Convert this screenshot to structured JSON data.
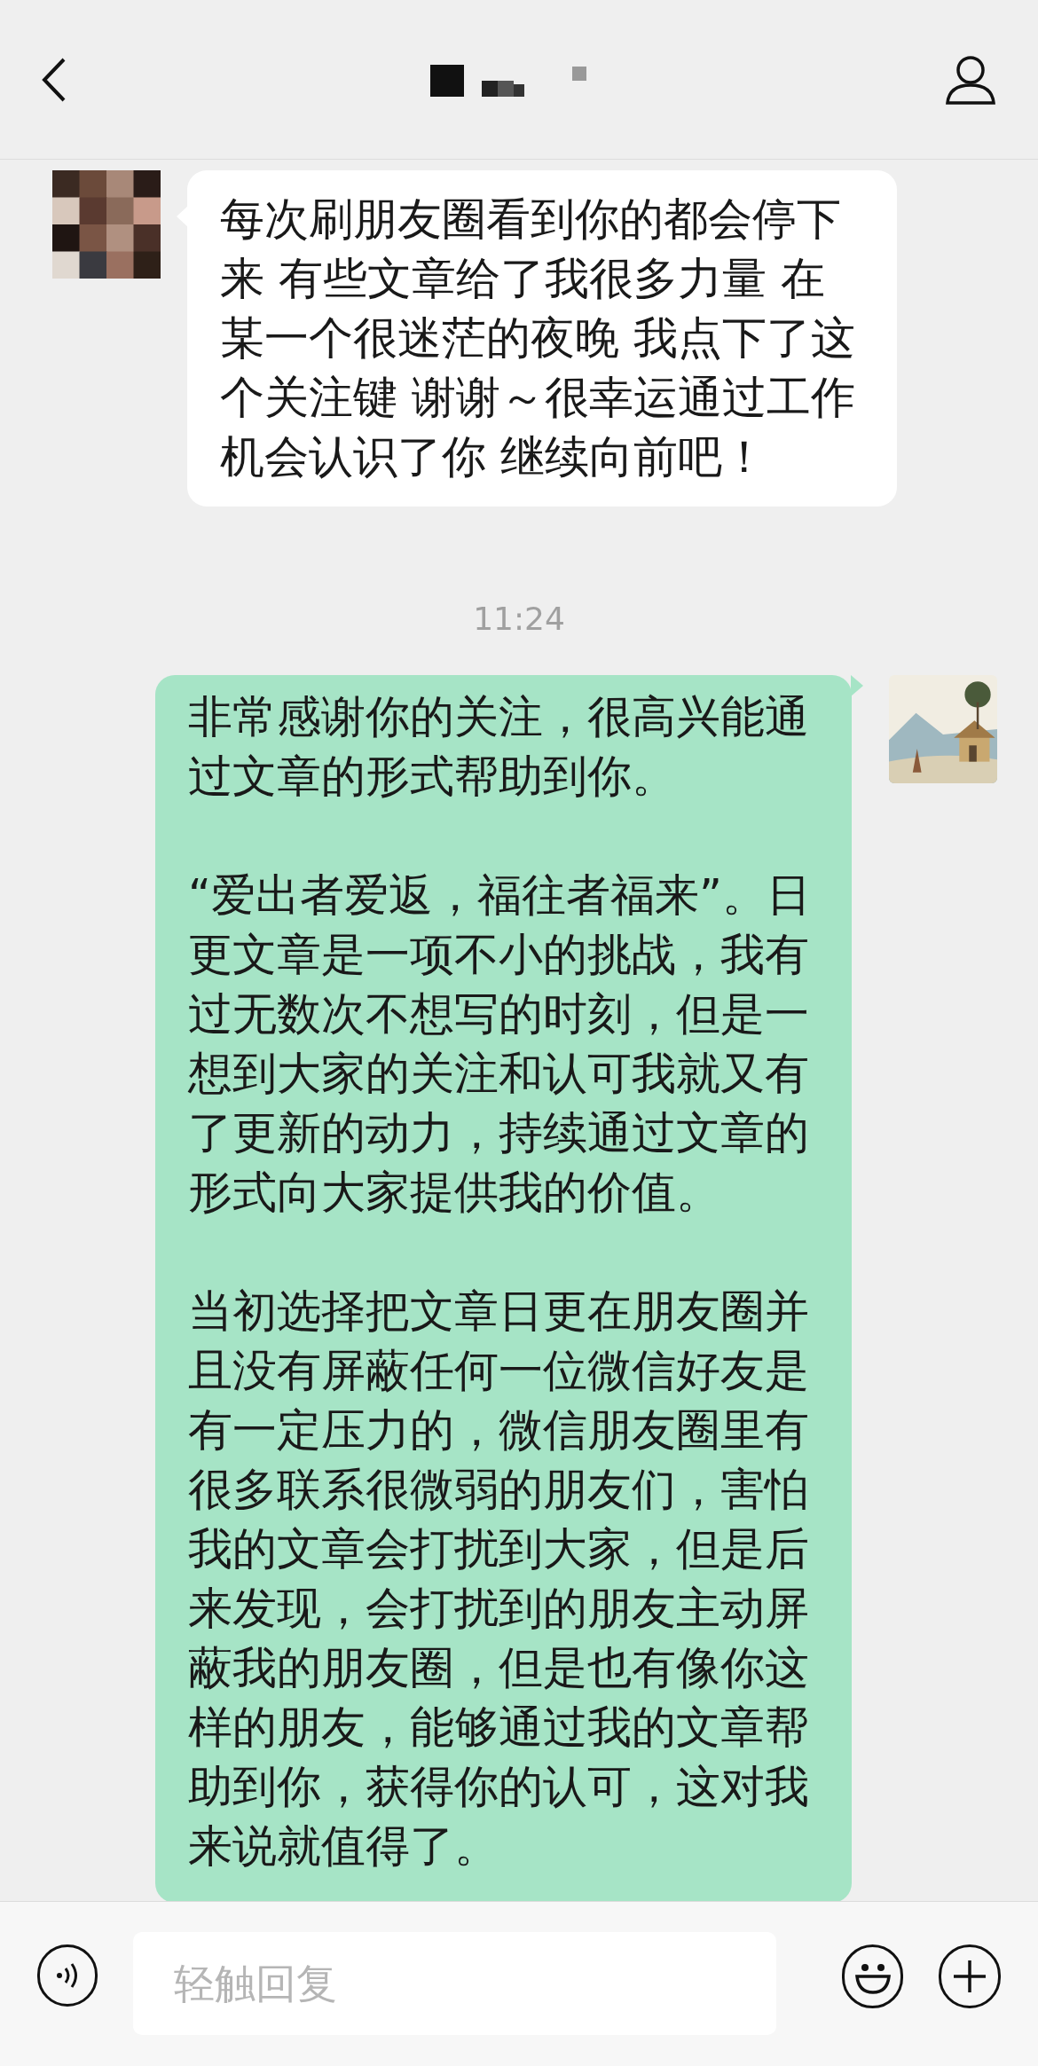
{
  "input": {
    "placeholder": "轻触回复"
  },
  "messages": [
    {
      "kind": "received",
      "paragraphs": [
        "每次刷朋友圈看到你的都会停下来 有些文章给了我很多力量 在某一个很迷茫的夜晚 我点下了这个关注键 谢谢～很幸运通过工作机会认识了你 继续向前吧！"
      ]
    },
    {
      "kind": "time",
      "text": "11:24"
    },
    {
      "kind": "sent",
      "paragraphs": [
        "非常感谢你的关注，很高兴能通过文章的形式帮助到你。",
        "“爱出者爱返，福往者福来”。日更文章是一项不小的挑战，我有过无数次不想写的时刻，但是一想到大家的关注和认可我就又有了更新的动力，持续通过文章的形式向大家提供我的价值。",
        "当初选择把文章日更在朋友圈并且没有屏蔽任何一位微信好友是有一定压力的，微信朋友圈里有很多联系很微弱的朋友们，害怕我的文章会打扰到大家，但是后来发现，会打扰到的朋友主动屏蔽我的朋友圈，但是也有像你这样的朋友，能够通过我的文章帮助到你，获得你的认可，这对我来说就值得了。"
      ]
    }
  ]
}
